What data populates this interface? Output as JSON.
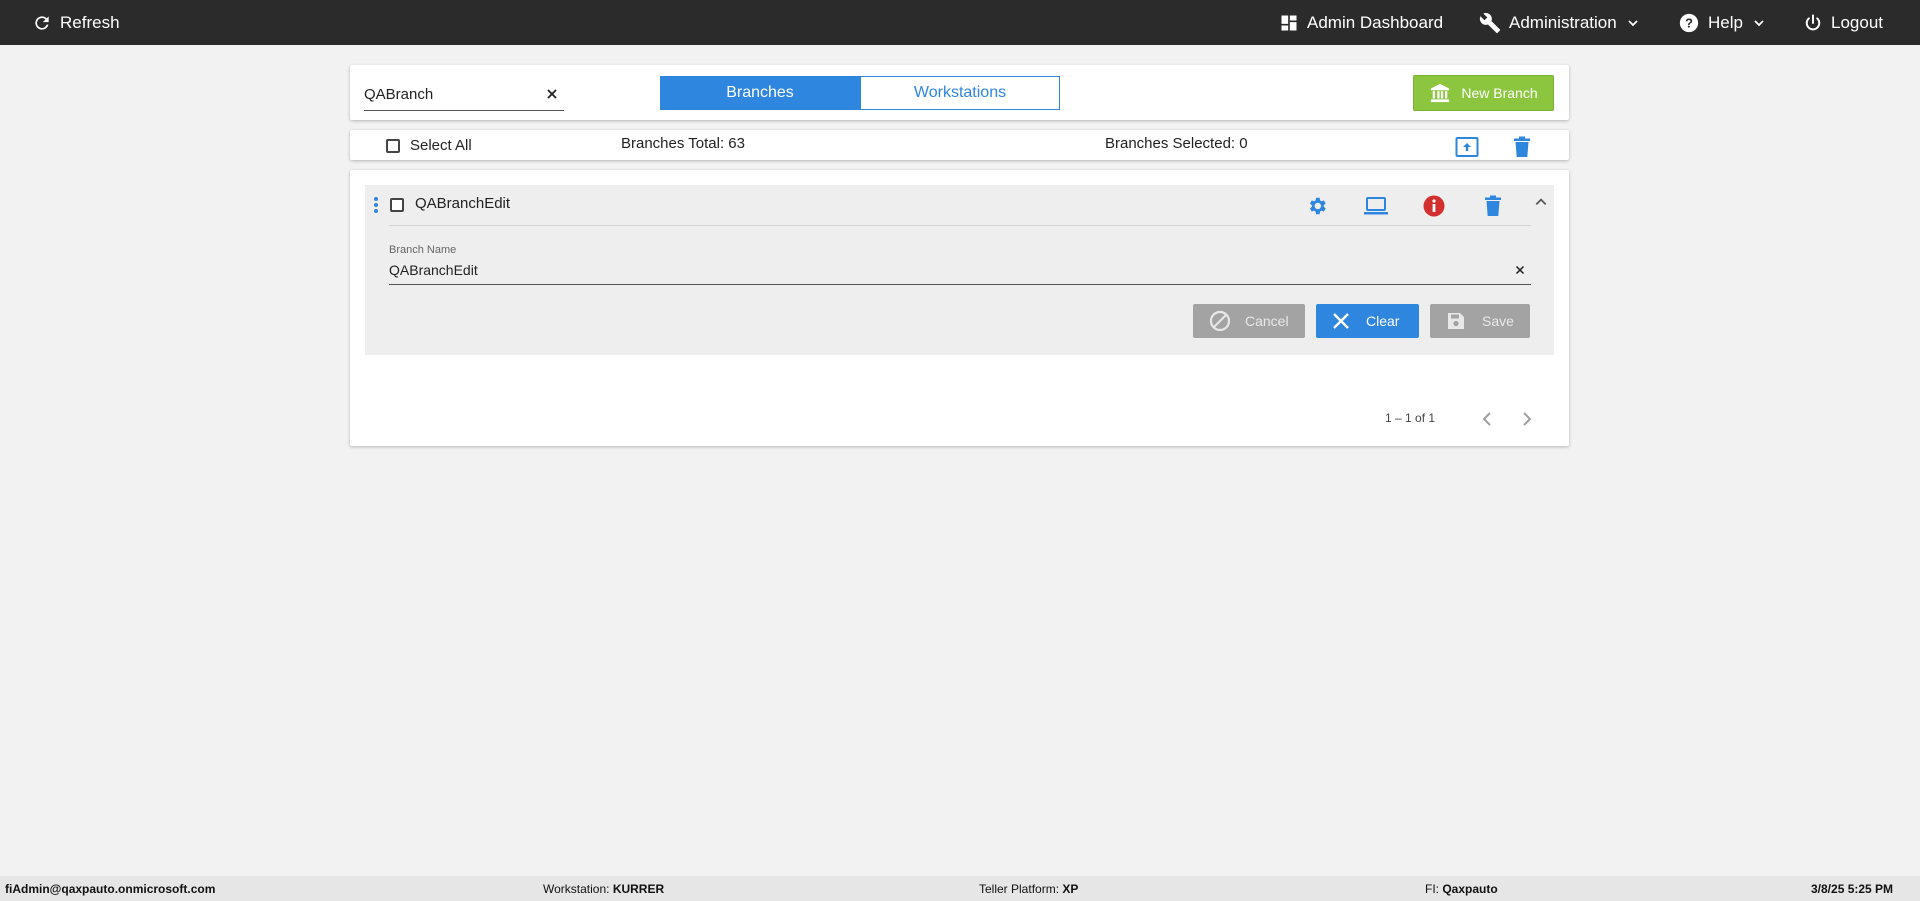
{
  "topbar": {
    "refresh_label": "Refresh",
    "admin_dashboard_label": "Admin Dashboard",
    "administration_label": "Administration",
    "help_label": "Help",
    "logout_label": "Logout"
  },
  "search": {
    "value": "QABranch",
    "placeholder": ""
  },
  "tabs": [
    {
      "label": "Branches",
      "active": true
    },
    {
      "label": "Workstations",
      "active": false
    }
  ],
  "new_branch_label": "New Branch",
  "summary": {
    "select_all_label": "Select All",
    "branches_total": "Branches Total: 63",
    "branches_selected": "Branches Selected: 0"
  },
  "branch_item": {
    "name": "QABranchEdit",
    "field_label": "Branch Name",
    "field_value": "QABranchEdit",
    "cancel_label": "Cancel",
    "clear_label": "Clear",
    "save_label": "Save"
  },
  "pagination": {
    "range": "1 – 1 of 1"
  },
  "footer": {
    "user": "fiAdmin@qaxpauto.onmicrosoft.com",
    "workstation_label": "Workstation: ",
    "workstation_value": "KURRER",
    "platform_label": "Teller Platform: ",
    "platform_value": "XP",
    "fi_label": "FI: ",
    "fi_value": "Qaxpauto",
    "datetime": "3/8/25 5:25 PM"
  },
  "colors": {
    "topbar": "#2b2b2b",
    "accent": "#2e86de",
    "new_branch": "#8cc63f",
    "info_icon": "#d32f2f",
    "disabled_button": "#a3a3a3"
  },
  "icons": [
    "refresh-icon",
    "dashboard-icon",
    "wrench-icon",
    "chevron-down-icon",
    "help-icon",
    "power-icon",
    "close-icon",
    "bank-icon",
    "upload-icon",
    "trash-icon",
    "drag-handle-icon",
    "gear-icon",
    "laptop-icon",
    "info-icon",
    "chevron-up-icon",
    "cancel-icon",
    "save-icon",
    "chevron-left-icon",
    "chevron-right-icon"
  ]
}
